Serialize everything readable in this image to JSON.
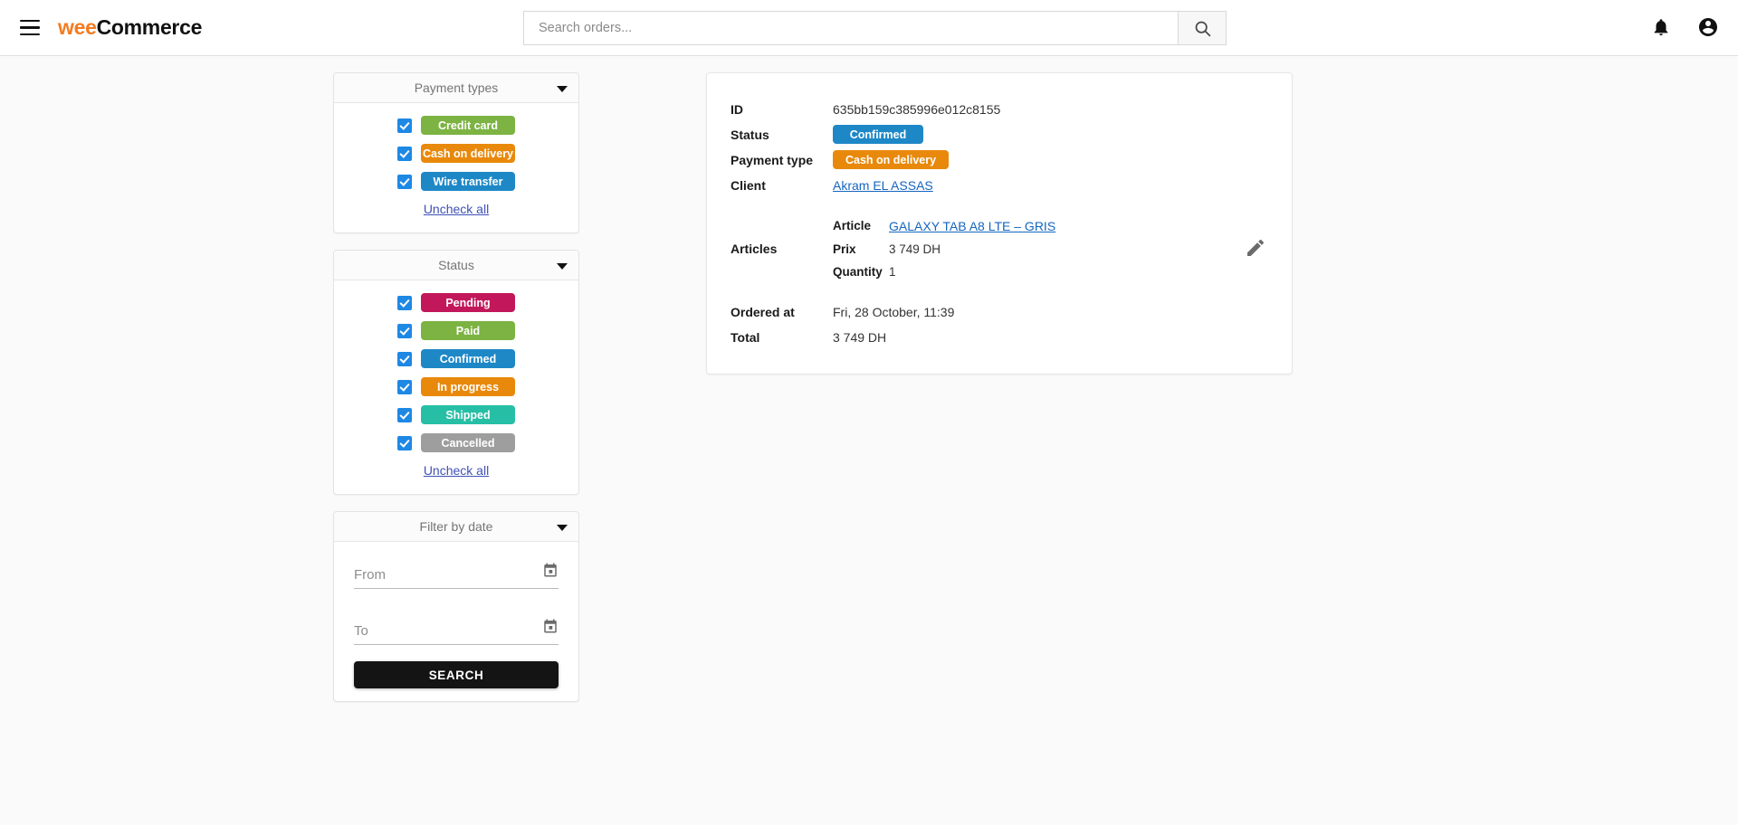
{
  "header": {
    "menu_icon": "hamburger-menu-icon",
    "brand_primary": "wee",
    "brand_secondary": "Commerce",
    "brand_color": "#f47b20",
    "search_placeholder": "Search orders...",
    "search_value": "",
    "search_icon": "search-icon",
    "notifications_icon": "bell-icon",
    "account_icon": "account-circle-icon"
  },
  "filters": {
    "payment_types": {
      "title": "Payment types",
      "caret_icon": "chevron-down-icon",
      "uncheck_all": "Uncheck all",
      "options": [
        {
          "label": "Credit card",
          "color": "#7cb342",
          "checked": true
        },
        {
          "label": "Cash on delivery",
          "color": "#e8890c",
          "checked": true
        },
        {
          "label": "Wire transfer",
          "color": "#1e88c7",
          "checked": true
        }
      ]
    },
    "status": {
      "title": "Status",
      "caret_icon": "chevron-down-icon",
      "uncheck_all": "Uncheck all",
      "options": [
        {
          "label": "Pending",
          "color": "#c2185b",
          "checked": true
        },
        {
          "label": "Paid",
          "color": "#7cb342",
          "checked": true
        },
        {
          "label": "Confirmed",
          "color": "#1e88c7",
          "checked": true
        },
        {
          "label": "In progress",
          "color": "#e8890c",
          "checked": true
        },
        {
          "label": "Shipped",
          "color": "#26bfa5",
          "checked": true
        },
        {
          "label": "Cancelled",
          "color": "#9e9e9e",
          "checked": true
        }
      ]
    },
    "date": {
      "title": "Filter by date",
      "caret_icon": "chevron-down-icon",
      "from_placeholder": "From",
      "from_value": "",
      "to_placeholder": "To",
      "to_value": "",
      "calendar_icon": "calendar-icon",
      "search_button": "SEARCH"
    }
  },
  "order": {
    "labels": {
      "id": "ID",
      "status": "Status",
      "payment_type": "Payment type",
      "client": "Client",
      "articles": "Articles",
      "article": "Article",
      "prix": "Prix",
      "quantity": "Quantity",
      "ordered_at": "Ordered at",
      "total": "Total"
    },
    "id": "635bb159c385996e012c8155",
    "status": {
      "label": "Confirmed",
      "color": "#1e88c7"
    },
    "payment_type": {
      "label": "Cash on delivery",
      "color": "#e8890c"
    },
    "client": "Akram EL ASSAS",
    "article": "GALAXY TAB A8 LTE – GRIS",
    "prix": "3 749 DH",
    "quantity": "1",
    "ordered_at": "Fri, 28 October, 11:39",
    "total": "3 749 DH",
    "edit_icon": "pencil-edit-icon"
  }
}
